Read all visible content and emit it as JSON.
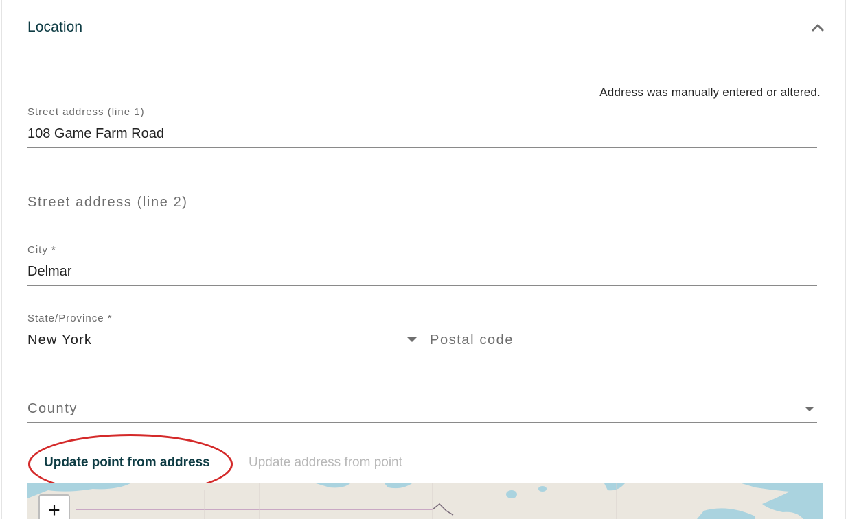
{
  "section": {
    "title": "Location",
    "collapse_icon": "chevron-up-icon"
  },
  "manual_note": "Address was manually entered or altered.",
  "fields": {
    "street1": {
      "label": "Street address (line 1)",
      "value": "108 Game Farm Road"
    },
    "street2": {
      "placeholder": "Street address (line 2)",
      "value": ""
    },
    "city": {
      "label": "City *",
      "value": "Delmar"
    },
    "state": {
      "label": "State/Province *",
      "value": "New York",
      "icon": "caret-down-icon"
    },
    "postal": {
      "placeholder": "Postal code",
      "value": ""
    },
    "county": {
      "placeholder": "County",
      "value": "",
      "icon": "caret-down-icon"
    }
  },
  "actions": {
    "update_point": "Update point from address",
    "update_address": "Update address from point"
  },
  "map": {
    "zoom_in_label": "+",
    "water_color": "#aad3df",
    "land_color": "#ebe7df"
  },
  "colors": {
    "title": "#0d3b43",
    "annotation": "#d42a2a",
    "disabled": "#b8b8b8"
  }
}
